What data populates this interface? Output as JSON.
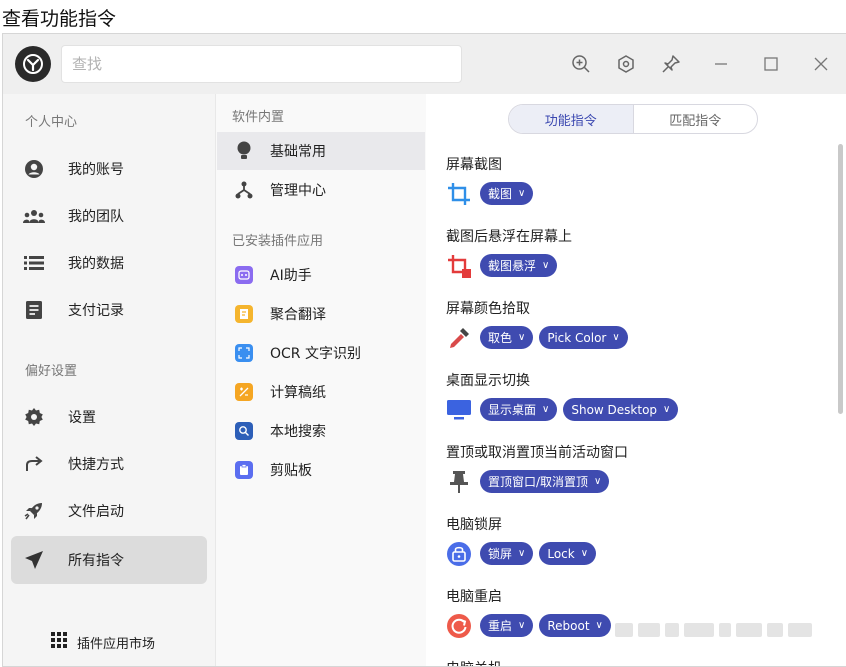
{
  "caption": "查看功能指令",
  "search": {
    "placeholder": "查找"
  },
  "toolbar": {
    "icons": [
      "zoom-in-icon",
      "hexagon-icon",
      "pin-icon",
      "minimize-icon",
      "maximize-icon",
      "close-icon"
    ]
  },
  "left_panel": {
    "section_personal": "个人中心",
    "personal_items": [
      {
        "label": "我的账号",
        "icon": "account-icon"
      },
      {
        "label": "我的团队",
        "icon": "team-icon"
      },
      {
        "label": "我的数据",
        "icon": "data-list-icon"
      },
      {
        "label": "支付记录",
        "icon": "receipt-icon"
      }
    ],
    "section_prefs": "偏好设置",
    "pref_items": [
      {
        "label": "设置",
        "icon": "gear-icon"
      },
      {
        "label": "快捷方式",
        "icon": "shortcut-arrow-icon"
      },
      {
        "label": "文件启动",
        "icon": "rocket-icon"
      },
      {
        "label": "所有指令",
        "icon": "send-icon",
        "active": true
      }
    ],
    "market_label": "插件应用市场"
  },
  "middle_panel": {
    "section_builtin": "软件内置",
    "builtin_items": [
      {
        "label": "基础常用",
        "active": true
      },
      {
        "label": "管理中心"
      }
    ],
    "section_plugins": "已安装插件应用",
    "plugin_items": [
      {
        "label": "AI助手",
        "color": "#8b6cf0"
      },
      {
        "label": "聚合翻译",
        "color": "#f5b52e"
      },
      {
        "label": "OCR 文字识别",
        "color": "#3a8ff0"
      },
      {
        "label": "计算稿纸",
        "color": "#f5a623"
      },
      {
        "label": "本地搜索",
        "color": "#2d5fb8"
      },
      {
        "label": "剪贴板",
        "color": "#5b6ef0"
      }
    ]
  },
  "right_panel": {
    "tabs": [
      "功能指令",
      "匹配指令"
    ],
    "commands": [
      {
        "title": "屏幕截图",
        "chips": [
          "截图"
        ]
      },
      {
        "title": "截图后悬浮在屏幕上",
        "chips": [
          "截图悬浮"
        ]
      },
      {
        "title": "屏幕颜色拾取",
        "chips": [
          "取色",
          "Pick Color"
        ]
      },
      {
        "title": "桌面显示切换",
        "chips": [
          "显示桌面",
          "Show Desktop"
        ]
      },
      {
        "title": "置顶或取消置顶当前活动窗口",
        "chips": [
          "置顶窗口/取消置顶"
        ]
      },
      {
        "title": "电脑锁屏",
        "chips": [
          "锁屏",
          "Lock"
        ]
      },
      {
        "title": "电脑重启",
        "chips": [
          "重启",
          "Reboot"
        ]
      },
      {
        "title": "电脑关机",
        "chips": []
      }
    ]
  },
  "colors": {
    "accent": "#3f4bb0",
    "chip_text": "#ffffff"
  }
}
